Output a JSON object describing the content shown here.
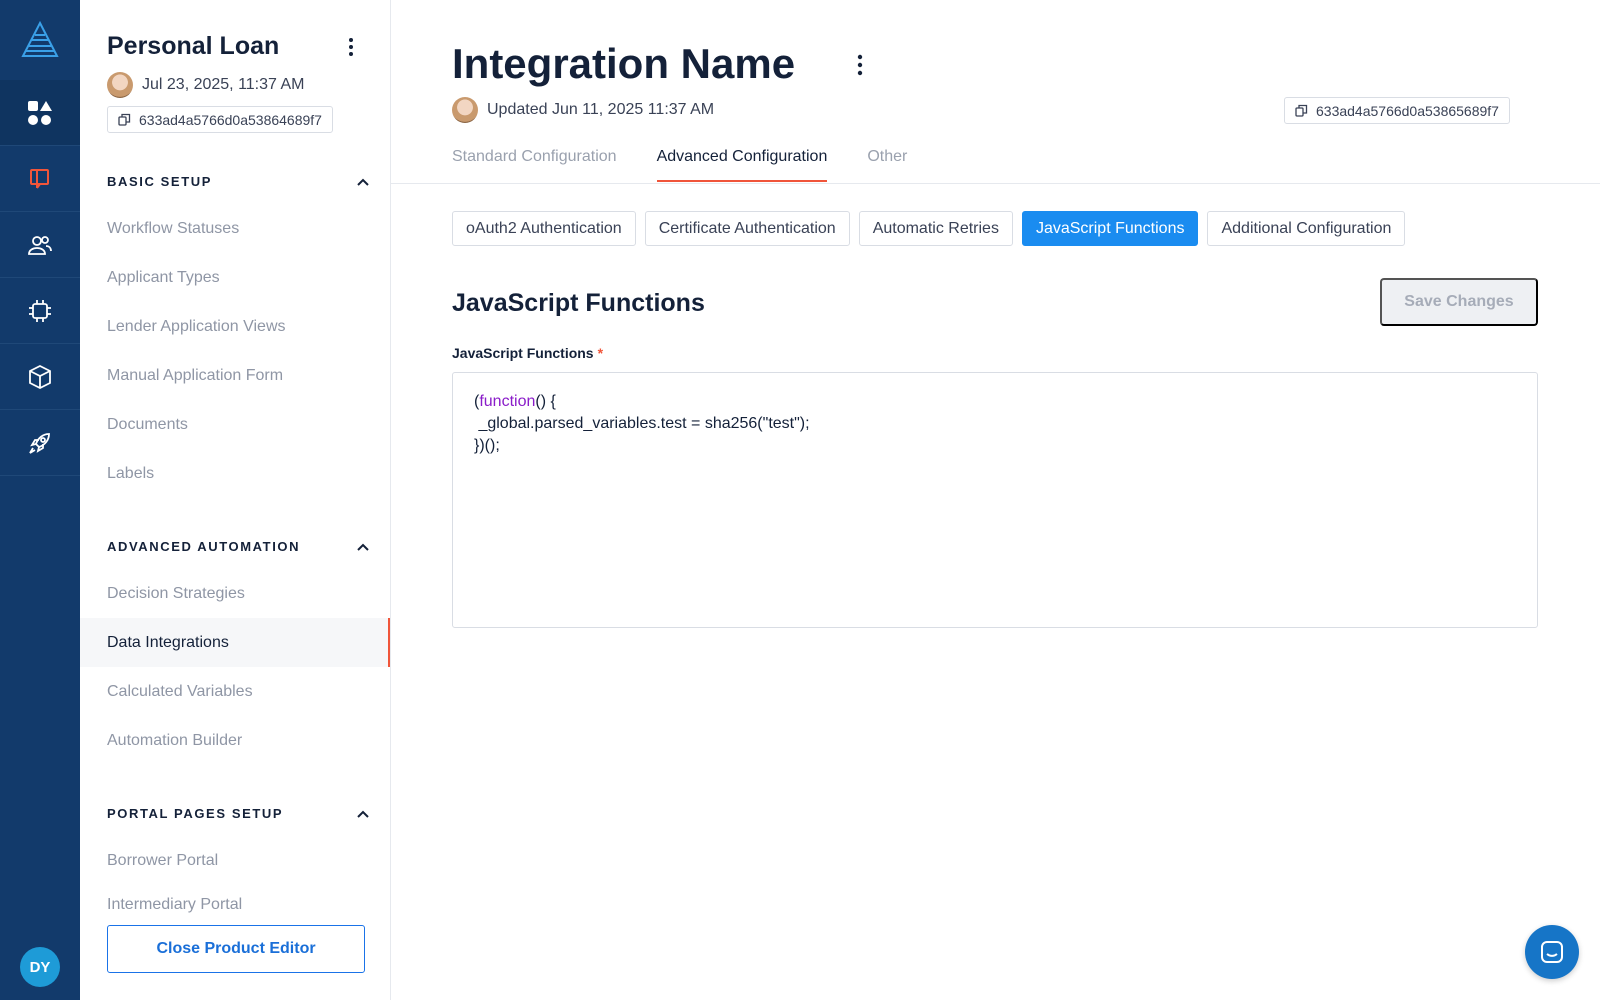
{
  "rail": {
    "items": [
      {
        "icon": "apps-icon"
      },
      {
        "icon": "products-icon"
      },
      {
        "icon": "users-icon"
      },
      {
        "icon": "chip-icon"
      },
      {
        "icon": "cube-icon"
      },
      {
        "icon": "rocket-icon"
      }
    ],
    "user_initials": "DY"
  },
  "sidebar": {
    "title": "Personal Loan",
    "date": "Jul 23, 2025, 11:37 AM",
    "id": "633ad4a5766d0a53864689f7",
    "sections": [
      {
        "heading": "BASIC SETUP",
        "items": [
          "Workflow Statuses",
          "Applicant Types",
          "Lender Application Views",
          "Manual Application Form",
          "Documents",
          "Labels"
        ]
      },
      {
        "heading": "ADVANCED AUTOMATION",
        "items": [
          "Decision Strategies",
          "Data Integrations",
          "Calculated Variables",
          "Automation Builder"
        ]
      },
      {
        "heading": "PORTAL PAGES SETUP",
        "items": [
          "Borrower Portal",
          "Intermediary Portal"
        ]
      }
    ],
    "active_item": "Data Integrations",
    "close_button": "Close Product Editor"
  },
  "main": {
    "title": "Integration Name",
    "updated": "Updated Jun 11, 2025 11:37 AM",
    "id": "633ad4a5766d0a53865689f7",
    "tabs": [
      "Standard Configuration",
      "Advanced Configuration",
      "Other"
    ],
    "active_tab": "Advanced Configuration",
    "subtabs": [
      "oAuth2 Authentication",
      "Certificate Authentication",
      "Automatic Retries",
      "JavaScript Functions",
      "Additional Configuration"
    ],
    "active_subtab": "JavaScript Functions",
    "section_title": "JavaScript Functions",
    "save_button": "Save Changes",
    "field_label": "JavaScript Functions",
    "required_mark": "*",
    "code": {
      "line1_open": "(",
      "line1_keyword": "function",
      "line1_rest": "() {",
      "line2": " _global.parsed_variables.test = sha256(\"test\");",
      "line3": "})();"
    }
  },
  "colors": {
    "rail_bg": "#123a6b",
    "accent_orange": "#f0553a",
    "accent_blue": "#1a8cf0",
    "keyword_purple": "#8a1cc9"
  }
}
